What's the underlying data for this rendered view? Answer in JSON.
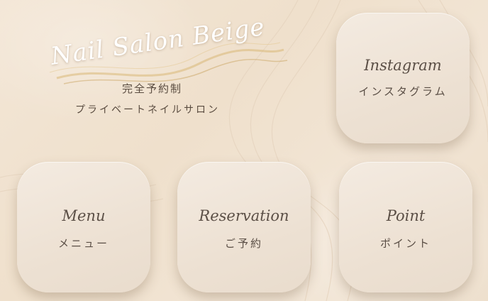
{
  "brand": {
    "title": "Nail Salon Beige",
    "subtitle_1": "完全予約制",
    "subtitle_2": "プライベートネイルサロン"
  },
  "cards": {
    "instagram": {
      "en": "Instagram",
      "ja": "インスタグラム"
    },
    "menu": {
      "en": "Menu",
      "ja": "メニュー"
    },
    "reservation": {
      "en": "Reservation",
      "ja": "ご予約"
    },
    "point": {
      "en": "Point",
      "ja": "ポイント"
    }
  },
  "colors": {
    "background": "#f0e2d0",
    "card": "#efe4d7",
    "text": "#5b4f46",
    "gold_accent": "#d8b877",
    "title": "#ffffff"
  }
}
